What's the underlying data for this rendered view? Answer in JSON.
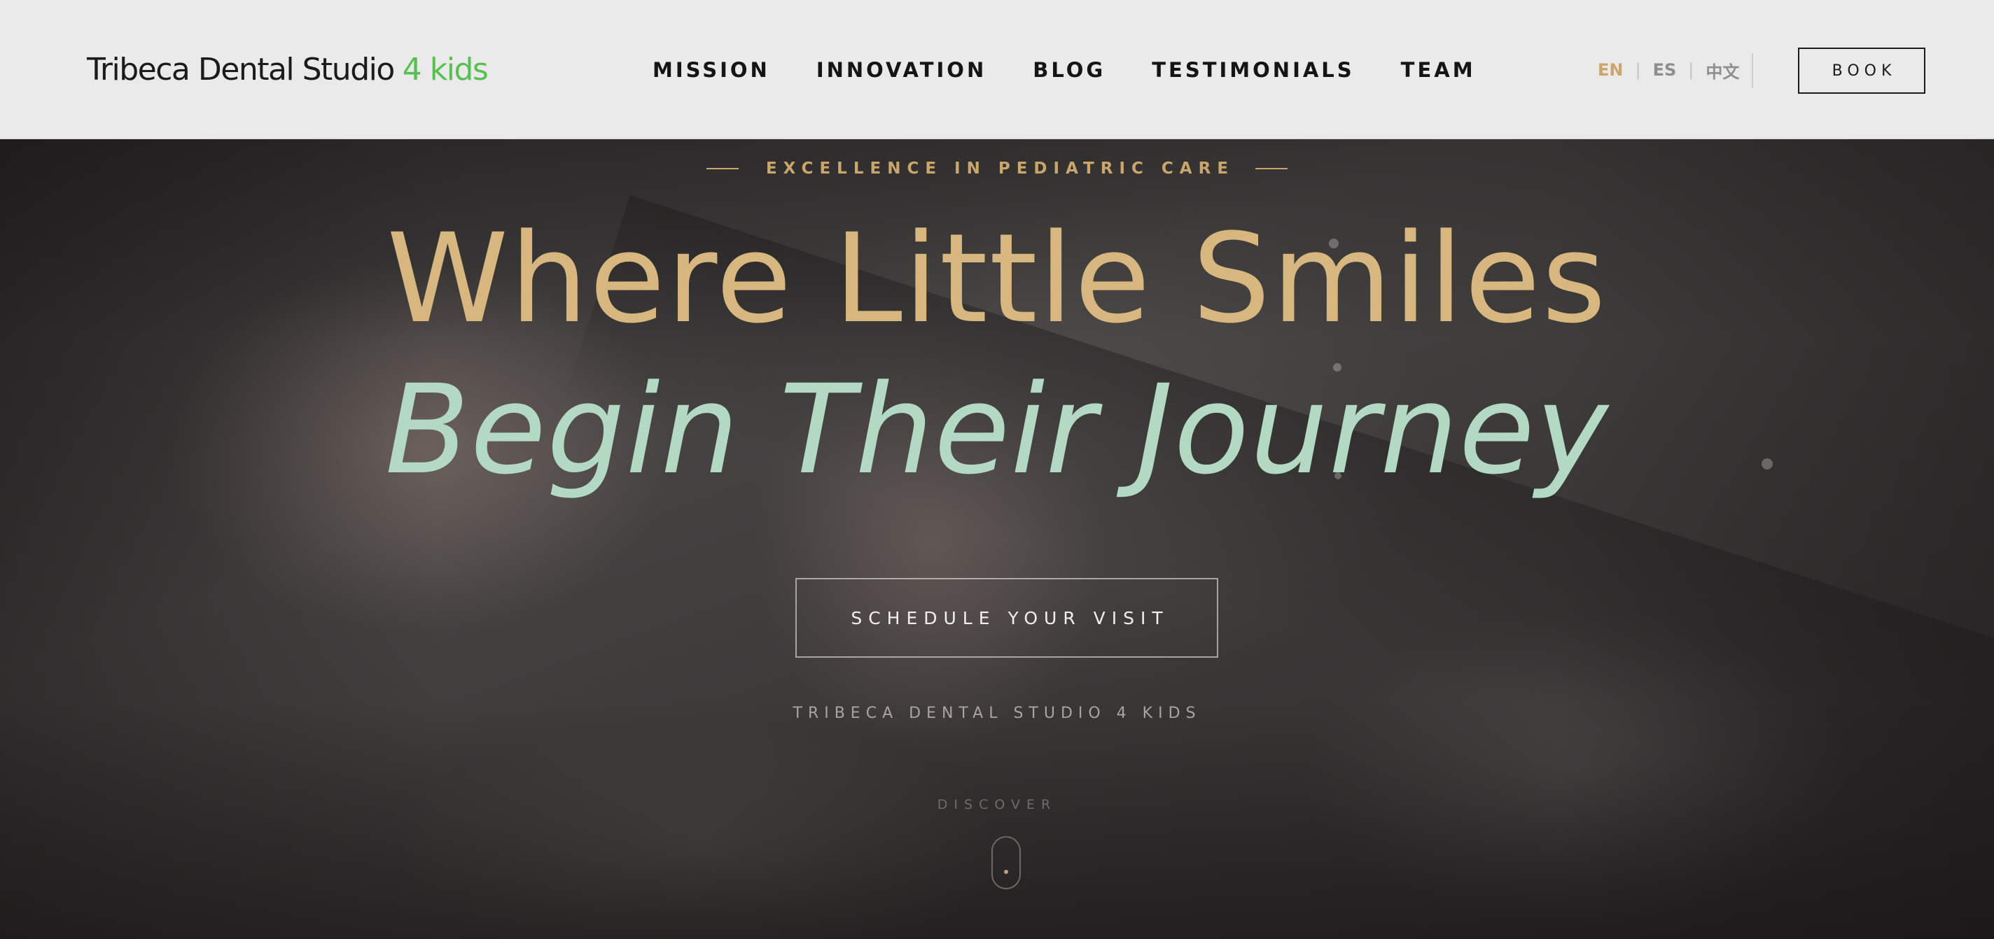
{
  "header": {
    "logo": {
      "main": "Tribeca Dental Studio",
      "accent": "4 kids",
      "accent_color": "#56c150"
    },
    "nav": [
      {
        "label": "MISSION"
      },
      {
        "label": "INNOVATION"
      },
      {
        "label": "BLOG"
      },
      {
        "label": "TESTIMONIALS"
      },
      {
        "label": "TEAM"
      }
    ],
    "languages": [
      {
        "label": "EN",
        "active": true
      },
      {
        "label": "ES",
        "active": false
      },
      {
        "label": "中文",
        "active": false
      }
    ],
    "lang_separator": "|",
    "book_label": "BOOK"
  },
  "hero": {
    "eyebrow": "EXCELLENCE IN PEDIATRIC CARE",
    "headline": "Where Little Smiles",
    "subheadline": "Begin Their Journey",
    "cta_label": "SCHEDULE YOUR VISIT",
    "tagline": "TRIBECA DENTAL STUDIO 4 KIDS",
    "discover_label": "DISCOVER"
  },
  "colors": {
    "gold": "#c9a66b",
    "mint": "#b3d9c4",
    "header_bg": "#ebeaea",
    "brand_green": "#56c150"
  },
  "icons": {
    "scroll": "mouse-scroll-icon"
  }
}
